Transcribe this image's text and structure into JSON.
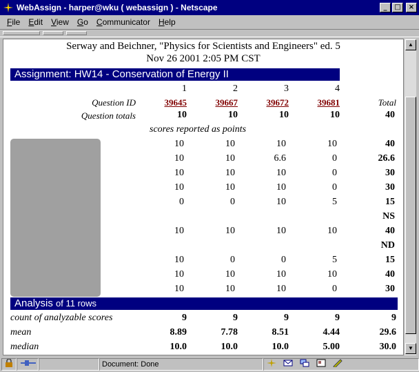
{
  "window": {
    "title": "WebAssign - harper@wku ( webassign ) - Netscape",
    "buttons": {
      "minimize": "_",
      "maximize": "□",
      "close": "×"
    }
  },
  "menu": [
    {
      "label": "File",
      "u": "F",
      "rest": "ile"
    },
    {
      "label": "Edit",
      "u": "E",
      "rest": "dit"
    },
    {
      "label": "View",
      "u": "V",
      "rest": "iew"
    },
    {
      "label": "Go",
      "u": "G",
      "rest": "o"
    },
    {
      "label": "Communicator",
      "u": "C",
      "rest": "ommunicator"
    },
    {
      "label": "Help",
      "u": "H",
      "rest": "elp"
    }
  ],
  "page": {
    "source": "Serway and Beichner, \"Physics for Scientists and Engineers\" ed. 5",
    "date": "Nov 26 2001 2:05 PM CST",
    "assignment_title": "Assignment: HW14 - Conservation of Energy II",
    "columns": [
      "1",
      "2",
      "3",
      "4"
    ],
    "question_id_label": "Question ID",
    "question_ids": [
      "39645",
      "39667",
      "39672",
      "39681"
    ],
    "total_header": "Total",
    "question_totals_label": "Question totals",
    "question_totals": [
      "10",
      "10",
      "10",
      "10"
    ],
    "question_totals_total": "40",
    "scores_note": "scores reported as points",
    "rows": [
      {
        "cells": [
          "10",
          "10",
          "10",
          "10"
        ],
        "total": "40"
      },
      {
        "cells": [
          "10",
          "10",
          "6.6",
          "0"
        ],
        "total": "26.6"
      },
      {
        "cells": [
          "10",
          "10",
          "10",
          "0"
        ],
        "total": "30"
      },
      {
        "cells": [
          "10",
          "10",
          "10",
          "0"
        ],
        "total": "30"
      },
      {
        "cells": [
          "0",
          "0",
          "10",
          "5"
        ],
        "total": "15"
      },
      {
        "cells": [
          "",
          "",
          "",
          ""
        ],
        "total": "NS"
      },
      {
        "cells": [
          "10",
          "10",
          "10",
          "10"
        ],
        "total": "40"
      },
      {
        "cells": [
          "",
          "",
          "",
          ""
        ],
        "total": "ND"
      },
      {
        "cells": [
          "10",
          "0",
          "0",
          "5"
        ],
        "total": "15"
      },
      {
        "cells": [
          "10",
          "10",
          "10",
          "10"
        ],
        "total": "40"
      },
      {
        "cells": [
          "10",
          "10",
          "10",
          "0"
        ],
        "total": "30"
      }
    ],
    "analysis_title": "Analysis",
    "analysis_subtitle": "of 11 rows",
    "stats": [
      {
        "label": "count of analyzable scores",
        "cells": [
          "9",
          "9",
          "9",
          "9"
        ],
        "total": "9"
      },
      {
        "label": "mean",
        "cells": [
          "8.89",
          "7.78",
          "8.51",
          "4.44"
        ],
        "total": "29.6"
      },
      {
        "label": "median",
        "cells": [
          "10.0",
          "10.0",
          "10.0",
          "5.00"
        ],
        "total": "30.0"
      }
    ]
  },
  "status": {
    "text": "Document: Done"
  },
  "colors": {
    "titlebar": "#000080",
    "band": "#000080",
    "link": "#800000",
    "chrome": "#c0c0c0"
  }
}
